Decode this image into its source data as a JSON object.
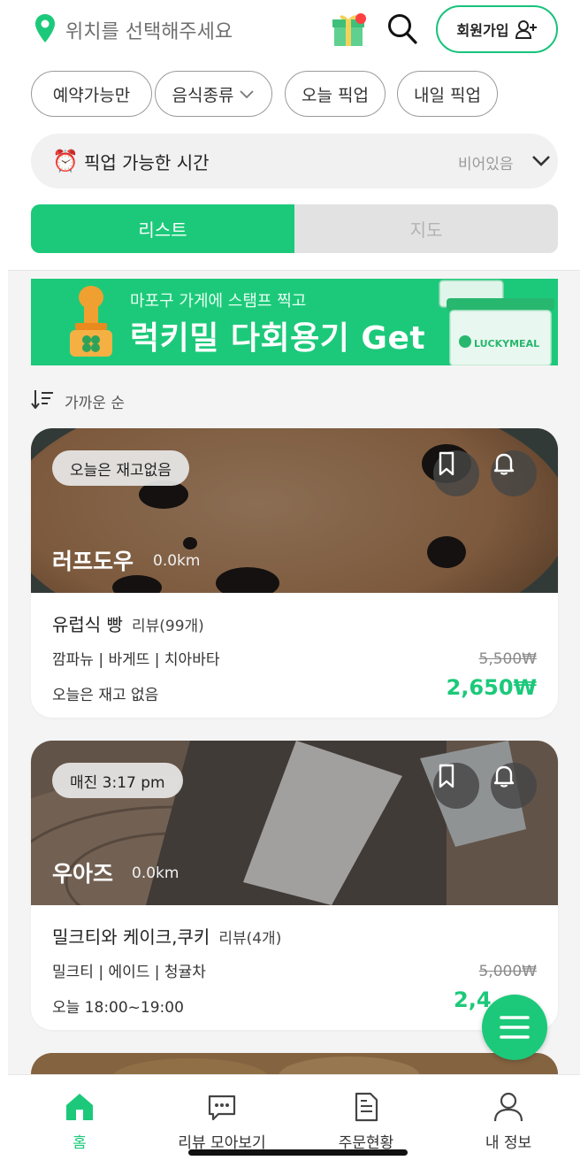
{
  "header": {
    "location_placeholder": "위치를 선택해주세요",
    "signup_label": "회원가입",
    "icons": [
      "location-pin-icon",
      "gift-icon",
      "search-icon",
      "add-user-icon"
    ]
  },
  "filters": [
    {
      "label": "예약가능만"
    },
    {
      "label": "음식종류",
      "has_dropdown": true
    },
    {
      "label": "오늘 픽업"
    },
    {
      "label": "내일 픽업"
    }
  ],
  "pickup": {
    "emoji": "⏰",
    "label": "픽업 가능한 시간",
    "status": "비어있음"
  },
  "tabs": [
    {
      "label": "리스트",
      "active": true
    },
    {
      "label": "지도",
      "active": false
    }
  ],
  "banner": {
    "subtitle": "마포구 가게에 스탬프 찍고",
    "title": "럭키밀 다회용기 Get",
    "brand": "LUCKYMEAL"
  },
  "sort": {
    "label": "가까운 순"
  },
  "stores": [
    {
      "status_pill": "오늘은 재고없음",
      "name": "러프도우",
      "distance": "0.0km",
      "product": "유럽식 빵",
      "review": "리뷰(99개)",
      "menu": "깜파뉴 | 바게뜨 | 치아바타",
      "pickup_time": "오늘은 재고 없음",
      "original_price": "5,500₩",
      "price": "2,650₩"
    },
    {
      "status_pill": "매진 3:17 pm",
      "name": "우아즈",
      "distance": "0.0km",
      "product": "밀크티와 케이크,쿠키",
      "review": "리뷰(4개)",
      "menu": "밀크티 | 에이드 | 청귤차",
      "pickup_time": "오늘 18:00~19:00",
      "original_price": "5,000₩",
      "price": "2,4"
    }
  ],
  "bottom_nav": [
    {
      "label": "홈",
      "icon": "home-icon",
      "active": true
    },
    {
      "label": "리뷰 모아보기",
      "icon": "chat-bubble-icon",
      "active": false
    },
    {
      "label": "주문현황",
      "icon": "document-icon",
      "active": false
    },
    {
      "label": "내 정보",
      "icon": "user-icon",
      "active": false
    }
  ],
  "colors": {
    "accent": "#1cc97a",
    "inactive_tab": "#e2e2e2",
    "text": "#222222",
    "muted": "#9a9a9a"
  }
}
